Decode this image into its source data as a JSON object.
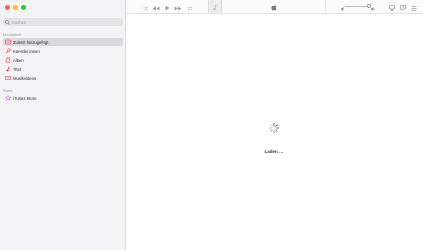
{
  "window": {
    "traffic_colors": {
      "close": "#ff5f57",
      "minimize": "#febc2e",
      "zoom": "#28c840"
    }
  },
  "sidebar": {
    "search_placeholder": "Suchen",
    "section_library": "Mediathek",
    "library_items": [
      {
        "label": "Zuletzt hinzugefügt",
        "icon": "clock-icon",
        "selected": true
      },
      {
        "label": "Künstler:innen",
        "icon": "microphone-icon",
        "selected": false
      },
      {
        "label": "Alben",
        "icon": "album-icon",
        "selected": false
      },
      {
        "label": "Titel",
        "icon": "music-note-icon",
        "selected": false
      },
      {
        "label": "Musikvideos",
        "icon": "video-icon",
        "selected": false
      }
    ],
    "section_store": "Store",
    "store_items": [
      {
        "label": "iTunes Store",
        "icon": "star-icon",
        "selected": false
      }
    ]
  },
  "toolbar": {
    "controls": [
      "shuffle-icon",
      "previous-icon",
      "play-icon",
      "next-icon",
      "repeat-icon"
    ],
    "right_controls": [
      "airplay-icon",
      "lyrics-icon",
      "queue-icon"
    ],
    "volume_level": 0.85
  },
  "content": {
    "loading_text": "Laden …"
  },
  "colors": {
    "accent": "#fa2d48",
    "sidebar_bg": "#f3f2f4",
    "selected_bg": "#d9d8dc"
  }
}
